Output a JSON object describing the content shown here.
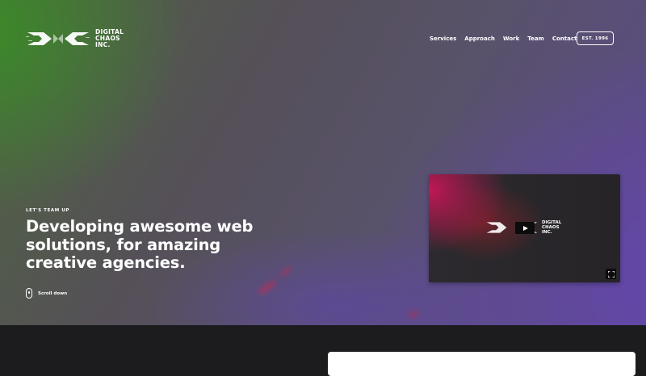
{
  "brand": {
    "name_lines": [
      "DIGITAL",
      "CHAOS",
      "INC."
    ]
  },
  "nav": {
    "items": [
      "Services",
      "Approach",
      "Work",
      "Team",
      "Contact"
    ]
  },
  "badge": "EST. 1996",
  "hero": {
    "eyebrow": "LET'S TEAM UP",
    "headline_lines": [
      "Developing awesome web",
      "solutions, for amazing",
      "creative agencies."
    ],
    "scroll_label": "Scroll down"
  },
  "video": {
    "logo_lines": [
      "DIGITAL",
      "CHAOS",
      "INC."
    ],
    "play_icon": "play-icon",
    "fullscreen_icon": "fullscreen-icon"
  },
  "colors": {
    "accent_green": "#3a8c28",
    "accent_purple": "#6446af",
    "accent_magenta": "#d2145a",
    "dark_section": "#1c1c1f"
  }
}
